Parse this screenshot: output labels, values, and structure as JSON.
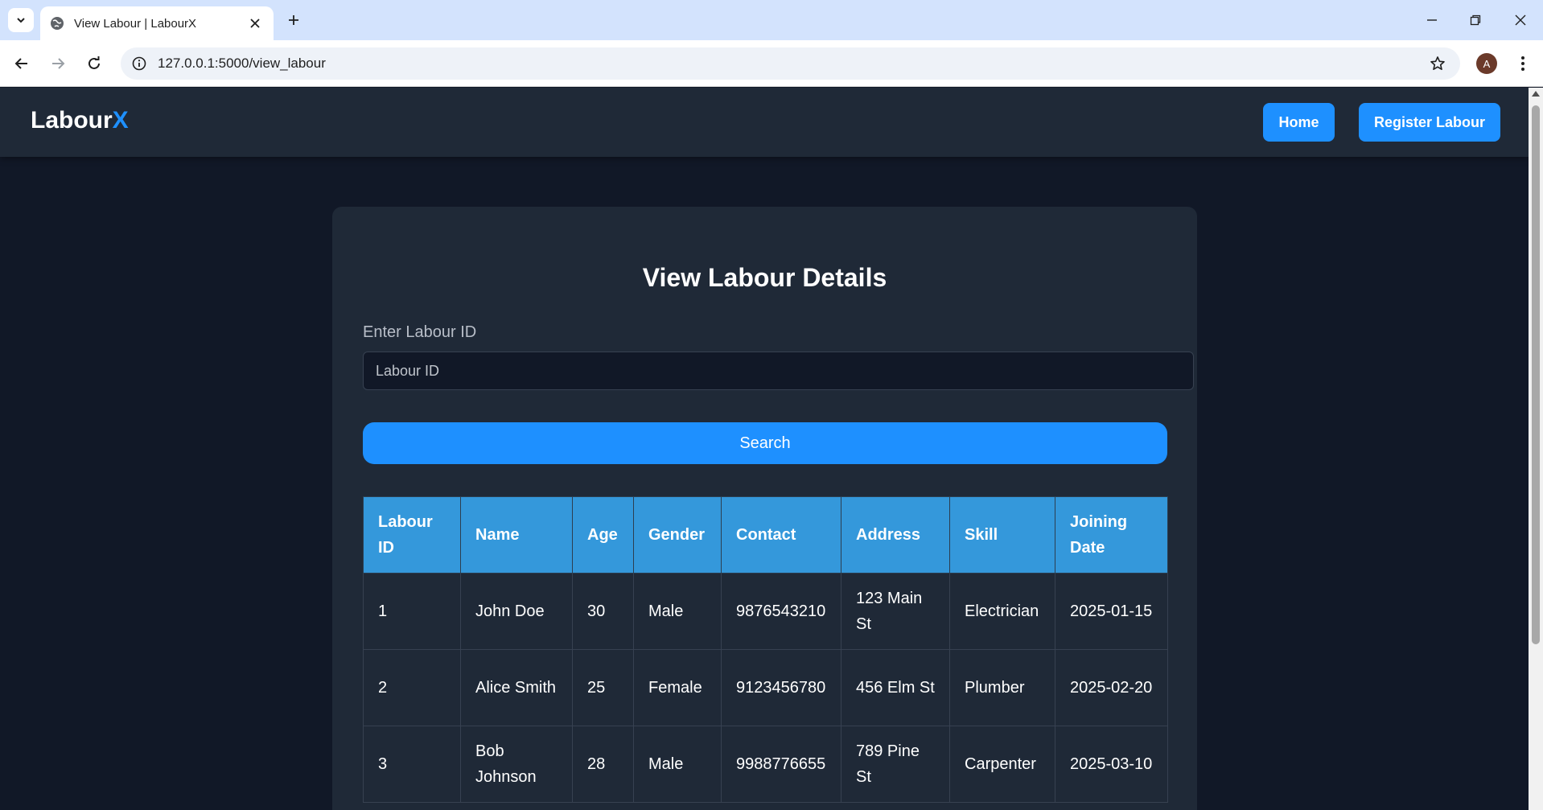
{
  "browser": {
    "tab_title": "View Labour | LabourX",
    "url": "127.0.0.1:5000/view_labour",
    "profile_initial": "A"
  },
  "app": {
    "logo_main": "Labour",
    "logo_accent": "X",
    "nav": {
      "home": "Home",
      "register": "Register Labour"
    },
    "accent_color": "#1e90ff"
  },
  "main": {
    "title": "View Labour Details",
    "id_label": "Enter Labour ID",
    "id_placeholder": "Labour ID",
    "search_label": "Search"
  },
  "table": {
    "headers": [
      "Labour ID",
      "Name",
      "Age",
      "Gender",
      "Contact",
      "Address",
      "Skill",
      "Joining Date"
    ],
    "rows": [
      [
        "1",
        "John Doe",
        "30",
        "Male",
        "9876543210",
        "123 Main St",
        "Electrician",
        "2025-01-15"
      ],
      [
        "2",
        "Alice Smith",
        "25",
        "Female",
        "9123456780",
        "456 Elm St",
        "Plumber",
        "2025-02-20"
      ],
      [
        "3",
        "Bob Johnson",
        "28",
        "Male",
        "9988776655",
        "789 Pine St",
        "Carpenter",
        "2025-03-10"
      ]
    ]
  }
}
